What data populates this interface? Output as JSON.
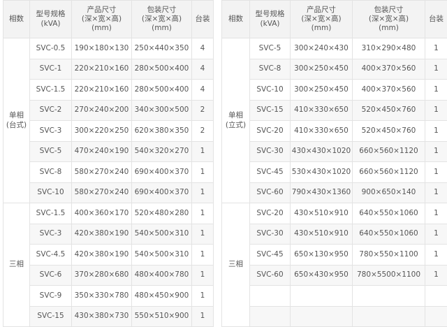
{
  "headers": {
    "category": "相数",
    "model": [
      "型号规格",
      "(kVA)"
    ],
    "product": [
      "产品尺寸",
      "(深×宽×高)",
      "(mm)"
    ],
    "package": [
      "包装尺寸",
      "(深×宽×高)",
      "(mm)"
    ],
    "qty": "台装"
  },
  "left_table": {
    "groups": [
      {
        "label": [
          "单相",
          "(台式)"
        ],
        "rows": [
          {
            "model": "SVC-0.5",
            "product": "190×180×130",
            "package": "250×440×350",
            "qty": "4"
          },
          {
            "model": "SVC-1",
            "product": "220×210×160",
            "package": "280×500×400",
            "qty": "4"
          },
          {
            "model": "SVC-1.5",
            "product": "220×210×160",
            "package": "280×500×400",
            "qty": "4"
          },
          {
            "model": "SVC-2",
            "product": "270×240×200",
            "package": "340×300×500",
            "qty": "2"
          },
          {
            "model": "SVC-3",
            "product": "300×220×250",
            "package": "620×380×350",
            "qty": "2"
          },
          {
            "model": "SVC-5",
            "product": "470×240×190",
            "package": "540×320×270",
            "qty": "1"
          },
          {
            "model": "SVC-8",
            "product": "580×270×240",
            "package": "690×400×370",
            "qty": "1"
          },
          {
            "model": "SVC-10",
            "product": "580×270×240",
            "package": "690×400×370",
            "qty": "1"
          }
        ]
      },
      {
        "label": [
          "三相"
        ],
        "rows": [
          {
            "model": "SVC-1.5",
            "product": "400×360×170",
            "package": "520×480×280",
            "qty": "1"
          },
          {
            "model": "SVC-3",
            "product": "420×380×190",
            "package": "540×500×310",
            "qty": "1"
          },
          {
            "model": "SVC-4.5",
            "product": "420×380×190",
            "package": "540×500×310",
            "qty": "1"
          },
          {
            "model": "SVC-6",
            "product": "370×280×680",
            "package": "480×400×780",
            "qty": "1"
          },
          {
            "model": "SVC-9",
            "product": "350×330×780",
            "package": "480×450×900",
            "qty": "1"
          },
          {
            "model": "SVC-15",
            "product": "430×380×730",
            "package": "550×510×900",
            "qty": "1"
          }
        ]
      }
    ]
  },
  "right_table": {
    "groups": [
      {
        "label": [
          "单相",
          "(立式)"
        ],
        "rows": [
          {
            "model": "SVC-5",
            "product": "300×240×430",
            "package": "310×290×480",
            "qty": "1"
          },
          {
            "model": "SVC-8",
            "product": "300×250×450",
            "package": "400×370×560",
            "qty": "1"
          },
          {
            "model": "SVC-10",
            "product": "300×250×450",
            "package": "400×370×560",
            "qty": "1"
          },
          {
            "model": "SVC-15",
            "product": "410×330×650",
            "package": "520×450×760",
            "qty": "1"
          },
          {
            "model": "SVC-20",
            "product": "410×330×650",
            "package": "520×450×760",
            "qty": "1"
          },
          {
            "model": "SVC-30",
            "product": "430×430×1020",
            "package": "660×560×1120",
            "qty": "1"
          },
          {
            "model": "SVC-45",
            "product": "530×430×1020",
            "package": "660×560×1120",
            "qty": "1"
          },
          {
            "model": "SVC-60",
            "product": "790×430×1360",
            "package": "900×650×140",
            "qty": "1"
          }
        ]
      },
      {
        "label": [
          "三相"
        ],
        "rows": [
          {
            "model": "SVC-20",
            "product": "430×510×910",
            "package": "640×550×1060",
            "qty": "1"
          },
          {
            "model": "SVC-30",
            "product": "430×510×910",
            "package": "640×550×1060",
            "qty": "1"
          },
          {
            "model": "SVC-45",
            "product": "650×130×950",
            "package": "780×550×1100",
            "qty": "1"
          },
          {
            "model": "SVC-60",
            "product": "650×430×950",
            "package": "780×5500×1100",
            "qty": "1"
          },
          {
            "model": "",
            "product": "",
            "package": "",
            "qty": ""
          },
          {
            "model": "",
            "product": "",
            "package": "",
            "qty": ""
          }
        ]
      }
    ]
  }
}
